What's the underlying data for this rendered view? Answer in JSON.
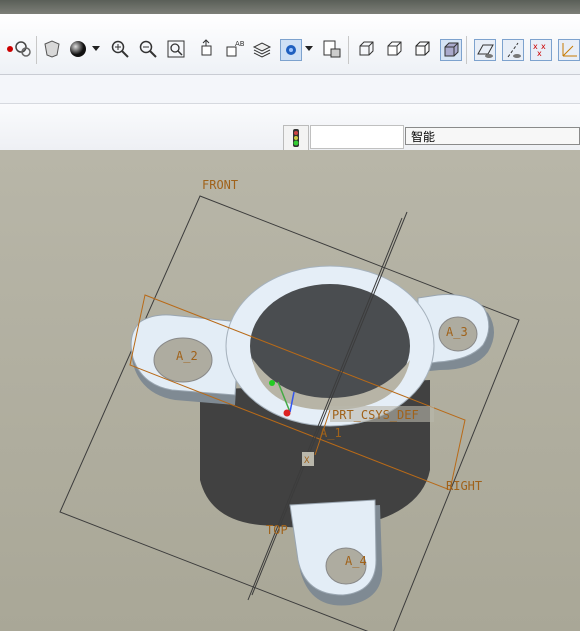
{
  "toolbar": {
    "icons": [
      "sketch-dot-icon",
      "regenerate-icon",
      "shield-icon",
      "shading-sphere-icon",
      "dropdown-arrow-icon",
      "zoom-in-icon",
      "zoom-out-icon",
      "zoom-fit-icon",
      "reorient-icon",
      "view-name-icon",
      "layers-icon",
      "spin-center-icon",
      "dropdown-arrow-icon",
      "saved-views-icon",
      "wireframe-icon",
      "hidden-line-icon",
      "no-hidden-icon",
      "shaded-icon",
      "datum-planes-icon",
      "datum-axes-icon",
      "datum-points-icon",
      "coordinate-systems-icon"
    ]
  },
  "filter": {
    "selected": "智能"
  },
  "model": {
    "datum_labels": {
      "front": "FRONT",
      "right": "RIGHT",
      "top": "TOP",
      "csys": "PRT_CSYS_DEF",
      "axis1": "A_1",
      "axis2": "A_2",
      "axis3": "A_3",
      "axis4": "A_4",
      "csys_axis": "X"
    }
  }
}
